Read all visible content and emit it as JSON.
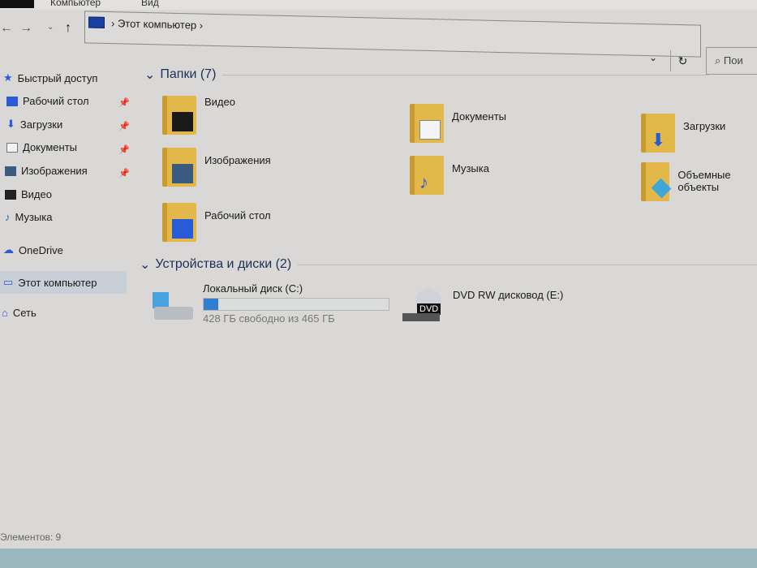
{
  "ribbon": {
    "tab_computer": "Компьютер",
    "tab_view": "Вид"
  },
  "address": {
    "crumb": "Этот компьютер",
    "search_placeholder": "Пои"
  },
  "sidebar": {
    "items": [
      {
        "label": "Быстрый доступ",
        "icon": "star-icon",
        "pinned": false
      },
      {
        "label": "Рабочий стол",
        "icon": "desktop-icon",
        "pinned": true
      },
      {
        "label": "Загрузки",
        "icon": "download-icon",
        "pinned": true
      },
      {
        "label": "Документы",
        "icon": "document-icon",
        "pinned": true
      },
      {
        "label": "Изображения",
        "icon": "image-icon",
        "pinned": true
      },
      {
        "label": "Видео",
        "icon": "video-icon",
        "pinned": false
      },
      {
        "label": "Музыка",
        "icon": "music-icon",
        "pinned": false
      },
      {
        "label": "OneDrive",
        "icon": "cloud-icon",
        "pinned": false
      },
      {
        "label": "Этот компьютер",
        "icon": "computer-icon",
        "pinned": false
      },
      {
        "label": "Сеть",
        "icon": "network-icon",
        "pinned": false
      }
    ]
  },
  "folders": {
    "header": "Папки (7)",
    "items": [
      {
        "label": "Видео"
      },
      {
        "label": "Документы"
      },
      {
        "label": "Загрузки"
      },
      {
        "label": "Изображения"
      },
      {
        "label": "Музыка"
      },
      {
        "label": "Объемные объекты"
      },
      {
        "label": "Рабочий стол"
      }
    ]
  },
  "devices": {
    "header": "Устройства и диски (2)",
    "items": [
      {
        "label": "Локальный диск (C:)",
        "free": "428 ГБ свободно из 465 ГБ",
        "used_fraction": 0.08
      },
      {
        "label": "DVD RW дисковод (E:)",
        "badge": "DVD"
      }
    ]
  },
  "status": {
    "count": "Элементов: 9"
  },
  "colors": {
    "accent": "#2f7ed0",
    "folder": "#e2b84a"
  }
}
